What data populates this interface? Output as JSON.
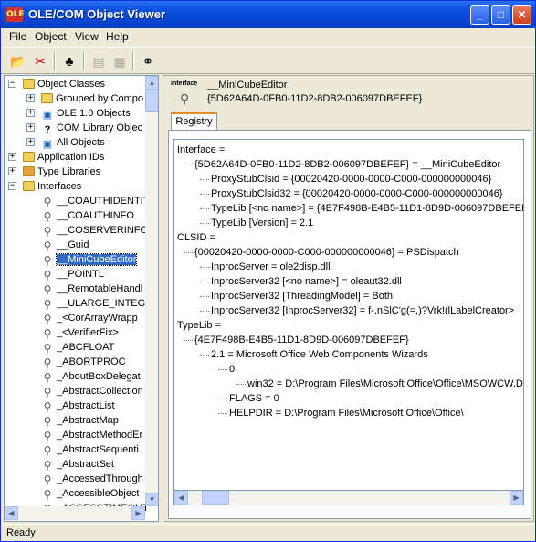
{
  "window": {
    "title": "OLE/COM Object Viewer",
    "app_icon": "OLE"
  },
  "menu": {
    "file": "File",
    "object": "Object",
    "view": "View",
    "help": "Help"
  },
  "toolbar": {
    "items": [
      "open-folder-icon",
      "connect-icon",
      "hierarchy-icon",
      "copy-icon",
      "paste-icon",
      "binoculars-icon"
    ]
  },
  "tree": {
    "object_classes": "Object Classes",
    "grouped": "Grouped by Compo",
    "ole10": "OLE 1.0 Objects",
    "comlib": "COM Library Objec",
    "all": "All Objects",
    "appids": "Application IDs",
    "typelibs": "Type Libraries",
    "interfaces": "Interfaces",
    "children": [
      "__COAUTHIDENTIT",
      "__COAUTHINFO",
      "__COSERVERINFO",
      "__Guid",
      "__MiniCubeEditor",
      "__POINTL",
      "__RemotableHandl",
      "__ULARGE_INTEGE",
      "_<CorArrayWrapp",
      "_<VerifierFix>",
      "_ABCFLOAT",
      "_ABORTPROC",
      "_AboutBoxDelegat",
      "_AbstractCollection",
      "_AbstractList",
      "_AbstractMap",
      "_AbstractMethodEr",
      "_AbstractSequenti",
      "_AbstractSet",
      "_AccessedThrough",
      "_AccessibleObject",
      "_ACCESSTIMEOUT"
    ],
    "selected_index": 4
  },
  "header": {
    "label": "interface",
    "name": "__MiniCubeEditor",
    "guid": "{5D62A64D-0FB0-11D2-8DB2-006097DBEFEF}"
  },
  "tab": "Registry",
  "registry": [
    "Interface =",
    "{5D62A64D-0FB0-11D2-8DB2-006097DBEFEF} = __MiniCubeEditor",
    "ProxyStubClsid = {00020420-0000-0000-C000-000000000046}",
    "ProxyStubClsid32 = {00020420-0000-0000-C000-000000000046}",
    "TypeLib [<no name>] = {4E7F498B-E4B5-11D1-8D9D-006097DBEFEF",
    "TypeLib [Version] = 2.1",
    "CLSID =",
    "{00020420-0000-0000-C000-000000000046} = PSDispatch",
    "InprocServer = ole2disp.dll",
    "InprocServer32 [<no name>] = oleaut32.dll",
    "InprocServer32 [ThreadingModel] = Both",
    "InprocServer32 [InprocServer32] = f-,nSlC'g(=,)?Vrk!(lLabelCreator>",
    "TypeLib =",
    "{4E7F498B-E4B5-11D1-8D9D-006097DBEFEF}",
    "2.1 = Microsoft Office Web Components Wizards",
    "0",
    "win32 = D:\\Program Files\\Microsoft Office\\Office\\MSOWCW.D",
    "FLAGS = 0",
    "HELPDIR = D:\\Program Files\\Microsoft Office\\Office\\"
  ],
  "status": "Ready"
}
